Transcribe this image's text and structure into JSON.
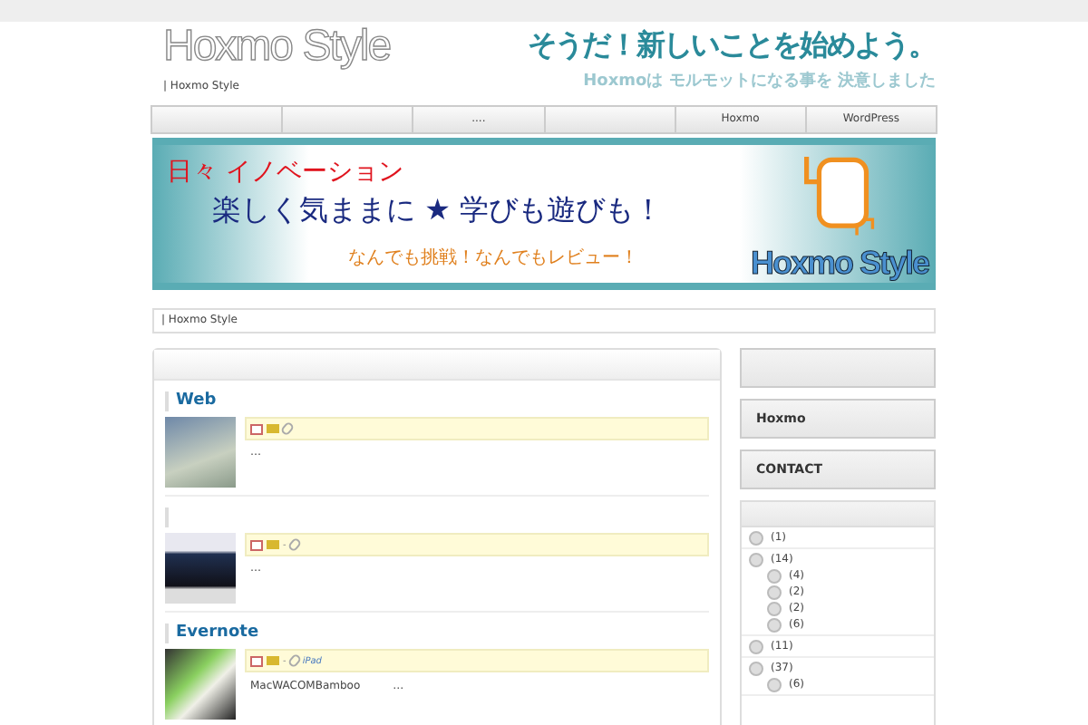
{
  "header": {
    "logo": "Hoxmo Style",
    "subtitle": "| Hoxmo Style",
    "tagline": "そうだ！新しいことを始めよう。",
    "tagline_sub": "Hoxmoは モルモットになる事を 決意しました"
  },
  "nav": [
    {
      "kind": "blank"
    },
    {
      "kind": "blank"
    },
    {
      "kind": "text",
      "label": "...."
    },
    {
      "kind": "blank"
    },
    {
      "kind": "text",
      "label": "Hoxmo"
    },
    {
      "kind": "text",
      "label": "WordPress"
    }
  ],
  "banner": {
    "line_1": "日々 イノベーション",
    "line_2": "楽しく気ままに ★ 学びも遊びも！",
    "line_3": "なんでも挑戦！なんでもレビュー！",
    "logo": "Hoxmo Style"
  },
  "breadcrumb": "| Hoxmo Style",
  "posts": [
    {
      "kind": "sky",
      "title": "Web",
      "excerpt": "…"
    },
    {
      "kind": "keyboard",
      "meta_text": "-",
      "excerpt": "…"
    },
    {
      "kind": "tablet",
      "title": "Evernote",
      "meta_text": "-",
      "tag": "iPad",
      "excerpt": "MacWACOMBamboo　　　…"
    }
  ],
  "sidebar": {
    "links": [
      {
        "kind": "blank"
      },
      {
        "kind": "text",
        "label": "Hoxmo"
      },
      {
        "kind": "text",
        "label": "CONTACT"
      }
    ],
    "categories": [
      {
        "count": "(1)"
      },
      {
        "count": "(14)",
        "children": [
          {
            "count": "(4)"
          },
          {
            "count": "(2)"
          },
          {
            "count": "(2)"
          },
          {
            "count": "(6)"
          }
        ]
      },
      {
        "count": "(11)"
      },
      {
        "count": "(37)",
        "children": [
          {
            "count": "(6)"
          }
        ]
      }
    ]
  }
}
